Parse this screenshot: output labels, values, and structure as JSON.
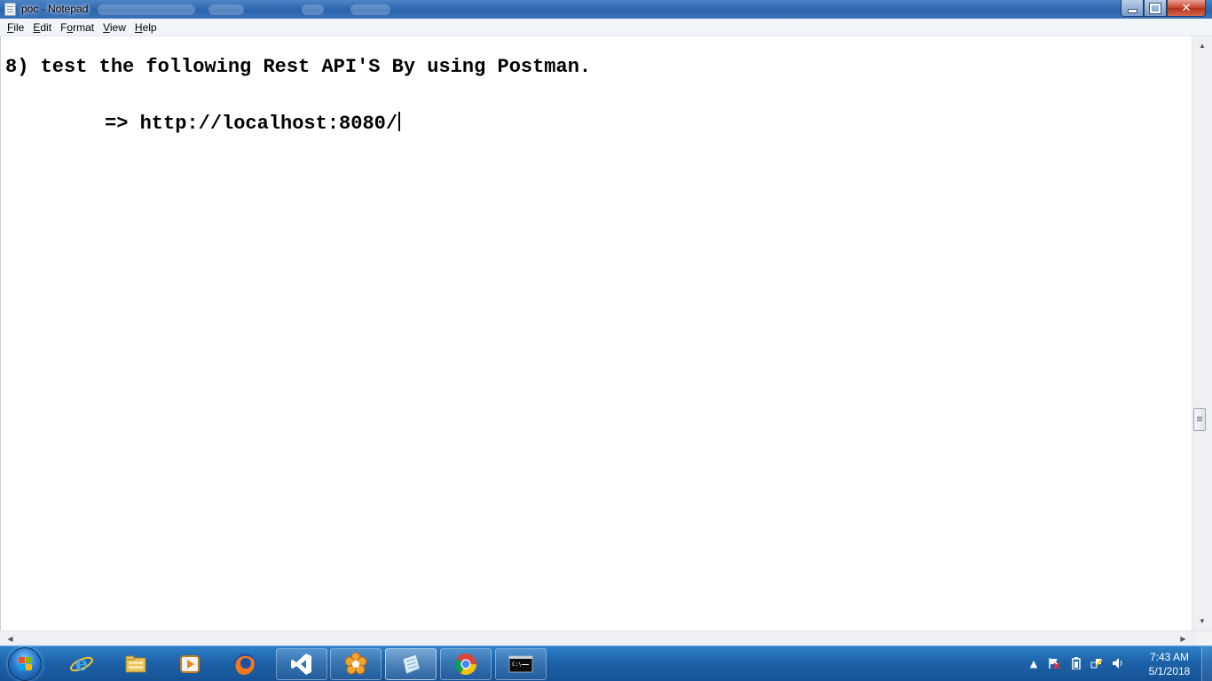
{
  "window": {
    "title": "poc - Notepad",
    "controls": {
      "minimize": "minimize",
      "maximize": "restore",
      "close": "✕"
    }
  },
  "menu": {
    "items": [
      {
        "label": "File",
        "key": "F",
        "rest": "ile"
      },
      {
        "label": "Edit",
        "key": "E",
        "rest": "dit"
      },
      {
        "label": "Format",
        "key": "o",
        "pre": "F",
        "rest": "rmat"
      },
      {
        "label": "View",
        "key": "V",
        "rest": "iew"
      },
      {
        "label": "Help",
        "key": "H",
        "rest": "elp"
      }
    ]
  },
  "document": {
    "line1": "8) test the following Rest API'S By using Postman.",
    "line2": "=> http://localhost:8080/"
  },
  "taskbar": {
    "apps": [
      {
        "name": "internet-explorer-icon",
        "state": "pinned"
      },
      {
        "name": "file-explorer-icon",
        "state": "pinned"
      },
      {
        "name": "media-player-icon",
        "state": "pinned"
      },
      {
        "name": "firefox-icon",
        "state": "pinned"
      },
      {
        "name": "visual-studio-code-icon",
        "state": "open"
      },
      {
        "name": "snipping-flower-icon",
        "state": "open"
      },
      {
        "name": "notepad-icon",
        "state": "active"
      },
      {
        "name": "chrome-icon",
        "state": "open"
      },
      {
        "name": "command-prompt-icon",
        "state": "open"
      }
    ],
    "clock": {
      "time": "7:43 AM",
      "date": "5/1/2018"
    },
    "tray": [
      "show-hidden-icons-icon",
      "action-center-flag-icon",
      "battery-icon",
      "network-icon",
      "volume-icon"
    ]
  },
  "colors": {
    "titlebar": "#2f69b2",
    "taskbar": "#1d62a8",
    "close_button": "#c7432b",
    "editor_bg": "#ffffff",
    "text": "#000000"
  }
}
